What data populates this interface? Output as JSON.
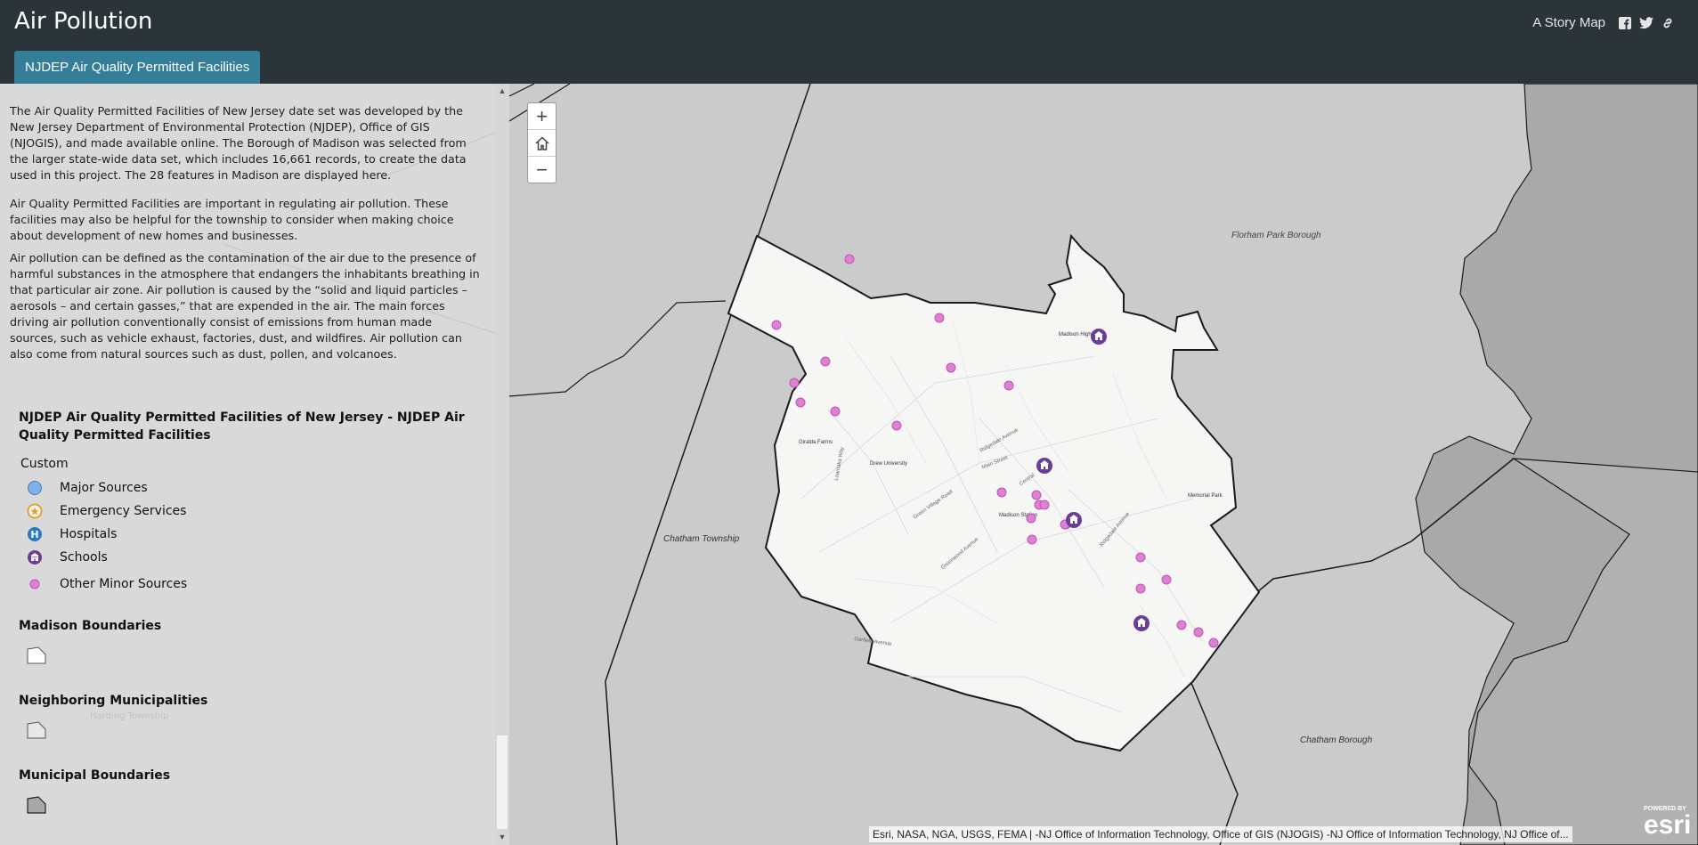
{
  "header": {
    "title": "Air Pollution",
    "story_link": "A Story Map",
    "social_icons": [
      "facebook-icon",
      "twitter-icon",
      "link-icon"
    ]
  },
  "tab": {
    "label": "NJDEP Air Quality Permitted Facilities"
  },
  "sidebar": {
    "paragraphs": [
      "The Air Quality Permitted Facilities of New Jersey date set was developed by the New Jersey Department of Environmental Protection (NJDEP), Office of GIS (NJOGIS), and made available online. The Borough of Madison was selected from the larger state-wide data set, which includes 16,661 records, to create the data used in this project. The 28 features in Madison are displayed here.",
      "Air Quality Permitted Facilities are important in regulating air pollution. These facilities may also be helpful for the township to consider when making choice about development of new homes and businesses.",
      "Air pollution can be defined as the contamination of the air due to the presence of harmful substances in the atmosphere that endangers the inhabitants breathing in that particular air zone. Air pollution is caused by the “solid and liquid particles – aerosols – and certain gasses,” that are expended in the air. The main forces driving air pollution conventionally consist of emissions from human made sources, such as vehicle exhaust, factories, dust, and wildfires. Air pollution can also come from natural sources such as dust, pollen, and volcanoes."
    ]
  },
  "legend": {
    "title": "NJDEP Air Quality Permitted Facilities of New Jersey - NJDEP Air Quality Permitted Facilities",
    "subtitle": "Custom",
    "items": [
      {
        "label": "Major Sources",
        "icon": "major-source-icon",
        "color": "#7fb0e6"
      },
      {
        "label": "Emergency Services",
        "icon": "emergency-star-icon",
        "color": "#e5a22a"
      },
      {
        "label": "Hospitals",
        "icon": "hospital-icon",
        "color": "#2a7ac0"
      },
      {
        "label": "Schools",
        "icon": "school-icon",
        "color": "#6a3d96"
      },
      {
        "label": "Other Minor Sources",
        "icon": "minor-source-icon",
        "color": "#e07fd6"
      }
    ],
    "sections": [
      {
        "title": "Madison Boundaries"
      },
      {
        "title": "Neighboring Municipalities"
      },
      {
        "title": "Municipal Boundaries"
      }
    ],
    "ghost_label": "Harding Township"
  },
  "map": {
    "labels": {
      "florham_park": "Florham Park Borough",
      "chatham_twp": "Chatham Township",
      "chatham_boro": "Chatham Borough",
      "madison_high": "Madison High",
      "giralda_farms": "Giralda Farms",
      "drew_univ": "Drew University",
      "madison_station": "Madison Station",
      "memorial_park": "Memorial Park",
      "ridgedale": "Ridgedale Avenue",
      "main_street": "Main Street",
      "central": "Central",
      "green_village": "Green Village Road",
      "greenwood": "Greenwood Avenue",
      "garfield": "Garfield Avenue",
      "loantaka": "Loantaka Way",
      "ridgedale_lower": "Ridgedale Avenue"
    },
    "zoom": {
      "in": "+",
      "out": "−"
    },
    "attribution": "Esri, NASA, NGA, USGS, FEMA | -NJ Office of Information Technology, Office of GIS (NJOGIS) -NJ Office of Information Technology, NJ Office of...",
    "esri": {
      "powered": "POWERED BY",
      "name": "esri"
    },
    "colors": {
      "minor": "#e07fd6",
      "school": "#6a3d96",
      "boundary": "#1a1a1a"
    }
  }
}
